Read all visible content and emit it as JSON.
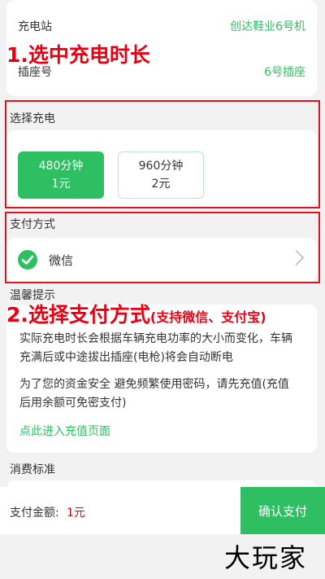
{
  "station": {
    "label": "充电站",
    "value": "创达鞋业6号机"
  },
  "socket": {
    "label": "插座号",
    "value": "6号插座"
  },
  "annotations": {
    "step1": "1.选中充电时长",
    "step2_main": "2.选择支付方式",
    "step2_note": "(支持微信、支付宝)"
  },
  "charge": {
    "title": "选择充电",
    "options": [
      {
        "duration": "480分钟",
        "price": "1元",
        "selected": true
      },
      {
        "duration": "960分钟",
        "price": "2元",
        "selected": false
      }
    ]
  },
  "payment": {
    "title": "支付方式",
    "method": "微信",
    "icon": "wechat-icon"
  },
  "tips": {
    "title": "温馨提示",
    "line1": "实际充电时长会根据车辆充电功率的大小而变化，车辆充满后或中途拔出插座(电枪)将会自动断电",
    "line2": "为了您的资金安全 避免频繁使用密码，请先充值(充值后用余额可免密支付)",
    "link": "点此进入充值页面"
  },
  "fees": {
    "title": "消费标准"
  },
  "footer": {
    "amount_label": "支付金额:",
    "amount_value": "1元",
    "confirm_label": "确认支付"
  },
  "watermark": "大玩家",
  "colors": {
    "accent": "#2fbf63",
    "annotation": "#e60012",
    "amount": "#e60012"
  }
}
